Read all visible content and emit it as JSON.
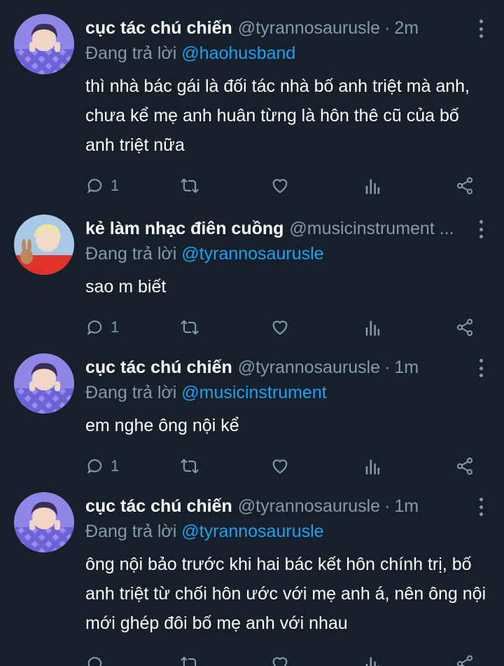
{
  "tweets": [
    {
      "name": "cục tác chú chiến",
      "handle": "@tyrannosaurusle",
      "time": "2m",
      "reply_prefix": "Đang trả lời",
      "reply_to": "@haohusband",
      "text": "thì nhà bác gái là đối tác nhà bố anh triệt mà anh, chưa kể mẹ anh huân từng là hôn thê cũ của bố anh triệt nữa",
      "reply_count": "1",
      "avatar": "avatar-boy-pattern"
    },
    {
      "name": "kẻ làm nhạc điên cuồng",
      "handle": "@musicinstrument ...",
      "time": "",
      "reply_prefix": "Đang trả lời",
      "reply_to": "@tyrannosaurusle",
      "text": "sao m biết",
      "reply_count": "1",
      "avatar": "avatar-boy-red-rabbit"
    },
    {
      "name": "cục tác chú chiến",
      "handle": "@tyrannosaurusle",
      "time": "1m",
      "reply_prefix": "Đang trả lời",
      "reply_to": "@musicinstrument",
      "text": "em nghe ông nội kể",
      "reply_count": "1",
      "avatar": "avatar-boy-pattern"
    },
    {
      "name": "cục tác chú chiến",
      "handle": "@tyrannosaurusle",
      "time": "1m",
      "reply_prefix": "Đang trả lời",
      "reply_to": "@tyrannosaurusle",
      "text": "ông nội bảo trước khi hai bác kết hôn chính trị, bố anh triệt từ chối hôn ước với mẹ anh á, nên ông nội mới ghép đôi bố mẹ anh với nhau",
      "reply_count": "",
      "avatar": "avatar-boy-pattern"
    }
  ],
  "separator": "·",
  "colors": {
    "background": "#15202b",
    "secondary_text": "#8899a6",
    "mention": "#1da1f2"
  },
  "icons": [
    "reply-icon",
    "retweet-icon",
    "like-icon",
    "stats-icon",
    "share-icon",
    "more-options-icon"
  ]
}
